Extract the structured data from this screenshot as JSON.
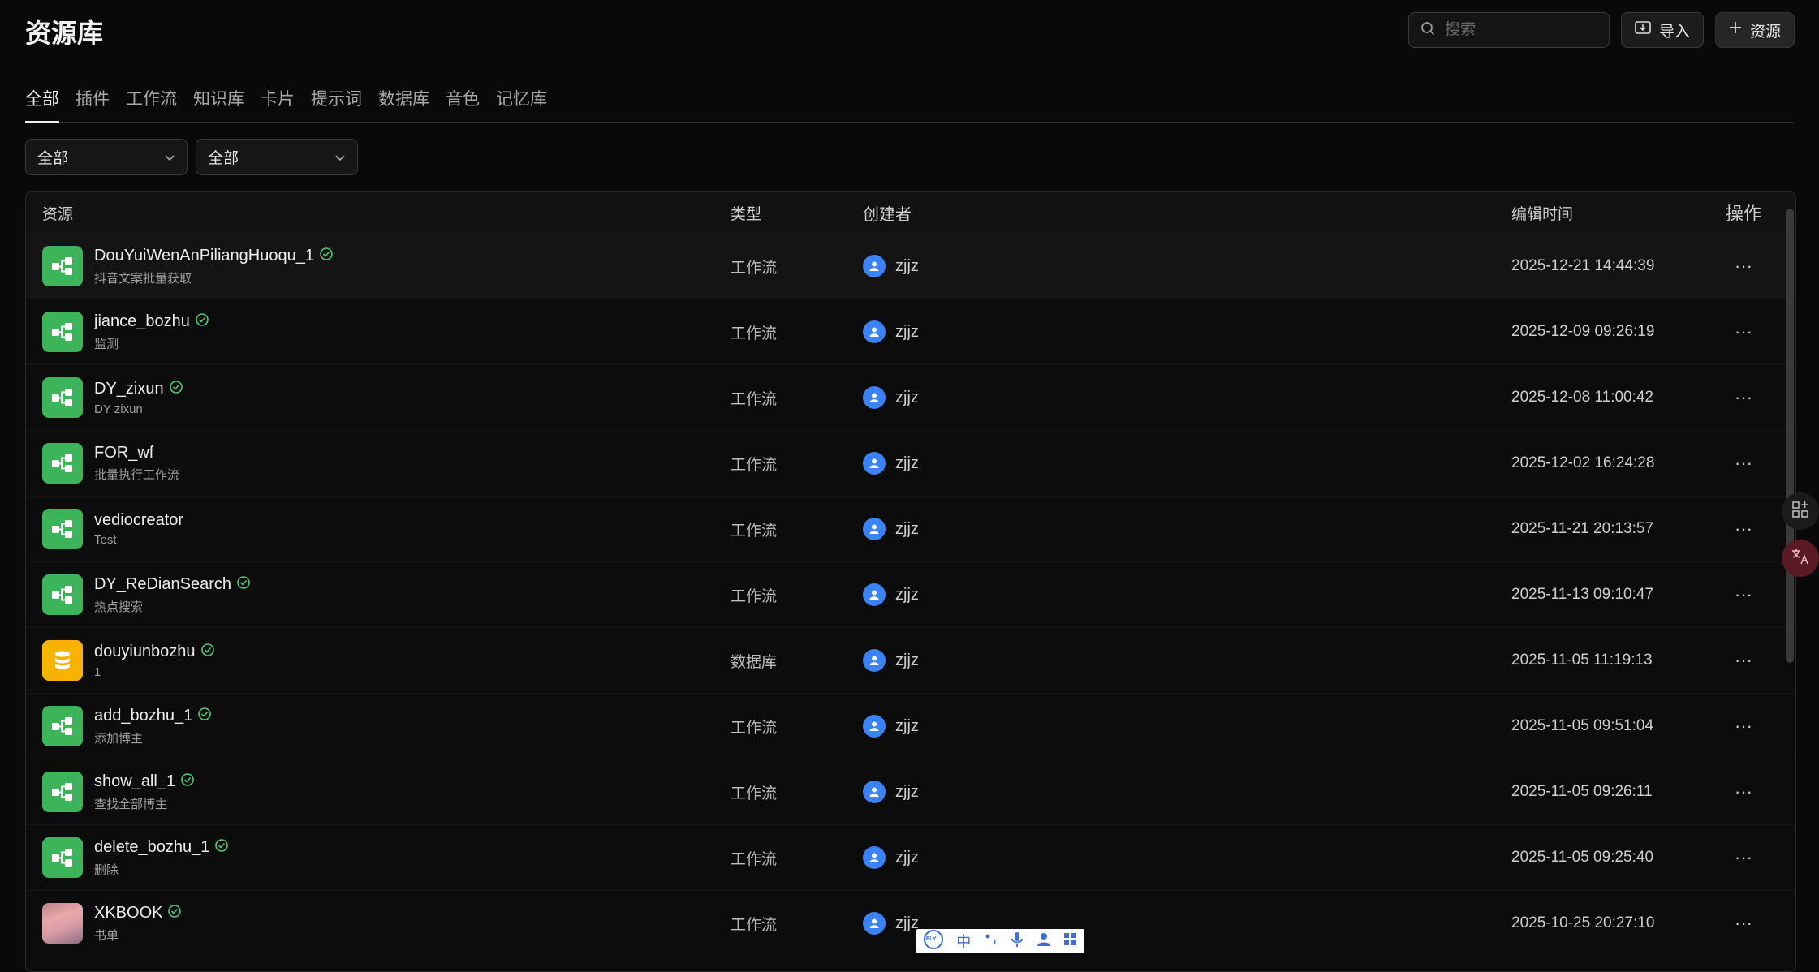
{
  "title": "资源库",
  "search": {
    "placeholder": "搜索"
  },
  "buttons": {
    "import": "导入",
    "add_resource": "资源"
  },
  "tabs": [
    "全部",
    "插件",
    "工作流",
    "知识库",
    "卡片",
    "提示词",
    "数据库",
    "音色",
    "记忆库"
  ],
  "active_tab": "全部",
  "filters": {
    "filter1": "全部",
    "filter2": "全部"
  },
  "columns": {
    "resource": "资源",
    "type": "类型",
    "creator": "创建者",
    "edit_time": "编辑时间",
    "actions": "操作"
  },
  "rows": [
    {
      "name": "DouYuiWenAnPiliangHuoqu_1",
      "desc": "抖音文案批量获取",
      "type": "工作流",
      "creator": "zjjz",
      "time": "2025-12-21 14:44:39",
      "published": true,
      "icon": "workflow-icon"
    },
    {
      "name": "jiance_bozhu",
      "desc": "监测",
      "type": "工作流",
      "creator": "zjjz",
      "time": "2025-12-09 09:26:19",
      "published": true,
      "icon": "workflow-icon"
    },
    {
      "name": "DY_zixun",
      "desc": "DY zixun",
      "type": "工作流",
      "creator": "zjjz",
      "time": "2025-12-08 11:00:42",
      "published": true,
      "icon": "workflow-icon"
    },
    {
      "name": "FOR_wf",
      "desc": "批量执行工作流",
      "type": "工作流",
      "creator": "zjjz",
      "time": "2025-12-02 16:24:28",
      "published": false,
      "icon": "workflow-icon"
    },
    {
      "name": "vediocreator",
      "desc": "Test",
      "type": "工作流",
      "creator": "zjjz",
      "time": "2025-11-21 20:13:57",
      "published": false,
      "icon": "workflow-icon"
    },
    {
      "name": "DY_ReDianSearch",
      "desc": "热点搜索",
      "type": "工作流",
      "creator": "zjjz",
      "time": "2025-11-13 09:10:47",
      "published": true,
      "icon": "workflow-icon"
    },
    {
      "name": "douyiunbozhu",
      "desc": "1",
      "type": "数据库",
      "creator": "zjjz",
      "time": "2025-11-05 11:19:13",
      "published": true,
      "icon": "database-icon"
    },
    {
      "name": "add_bozhu_1",
      "desc": "添加博主",
      "type": "工作流",
      "creator": "zjjz",
      "time": "2025-11-05 09:51:04",
      "published": true,
      "icon": "workflow-icon"
    },
    {
      "name": "show_all_1",
      "desc": "查找全部博主",
      "type": "工作流",
      "creator": "zjjz",
      "time": "2025-11-05 09:26:11",
      "published": true,
      "icon": "workflow-icon"
    },
    {
      "name": "delete_bozhu_1",
      "desc": "删除",
      "type": "工作流",
      "creator": "zjjz",
      "time": "2025-11-05 09:25:40",
      "published": true,
      "icon": "workflow-icon"
    },
    {
      "name": "XKBOOK",
      "desc": "书单",
      "type": "工作流",
      "creator": "zjjz",
      "time": "2025-10-25 20:27:10",
      "published": true,
      "icon": "image-thumbnail"
    }
  ],
  "more_symbol": "···",
  "ime": {
    "logo": "iFLY",
    "lang": "中"
  },
  "colors": {
    "accent_green": "#3cb55a",
    "db_yellow": "#f6b400",
    "avatar_blue": "#3b82f6",
    "check_green": "#4ccb6e"
  }
}
